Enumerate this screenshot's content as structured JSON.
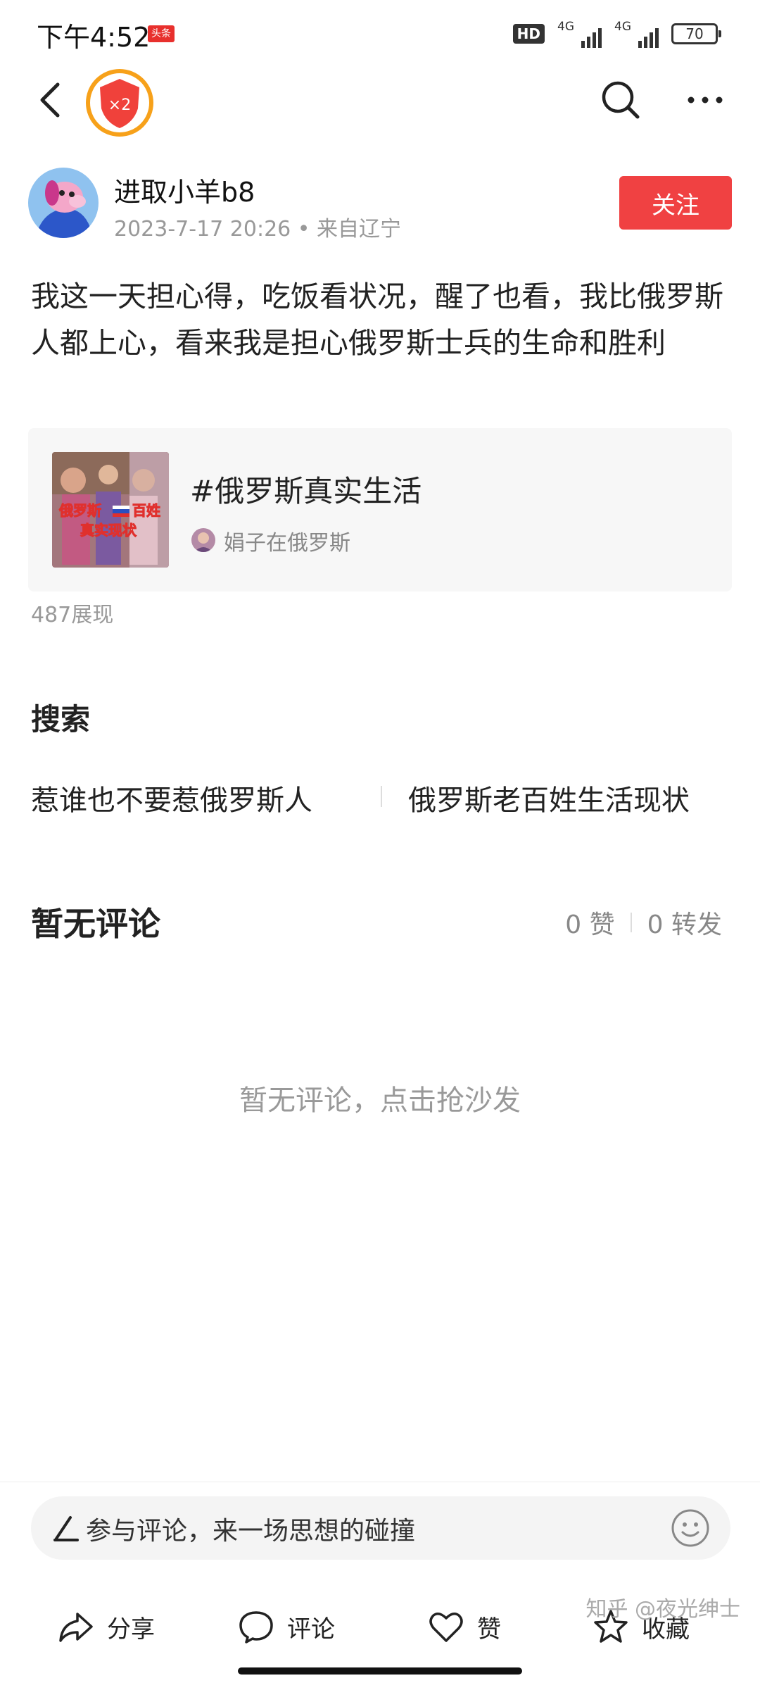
{
  "status_bar": {
    "time": "下午4:52",
    "app_badge": "头条",
    "hd_label": "HD",
    "net1": "4G",
    "net2": "4G",
    "battery": "70"
  },
  "nav": {
    "reward_label": "×2"
  },
  "author": {
    "name": "进取小羊b8",
    "meta": "2023-7-17 20:26 • 来自辽宁",
    "follow_label": "关注"
  },
  "post": {
    "text": "我这一天担心得，吃饭看状况，醒了也看，我比俄罗斯人都上心，看来我是担心俄罗斯士兵的生命和胜利",
    "views": "487展现"
  },
  "topic": {
    "title": "#俄罗斯真实生活",
    "thumb_caption_1": "俄罗斯",
    "thumb_caption_2": "百姓",
    "thumb_caption_3": "真实现状",
    "source": "娟子在俄罗斯"
  },
  "search": {
    "title": "搜索",
    "keywords": [
      "惹谁也不要惹俄罗斯人",
      "俄罗斯老百姓生活现状"
    ]
  },
  "comments": {
    "title": "暂无评论",
    "likes": "0 赞",
    "reposts": "0 转发",
    "empty_text": "暂无评论，点击抢沙发"
  },
  "bottom": {
    "input_placeholder": "参与评论，来一场思想的碰撞",
    "share_label": "分享",
    "comment_label": "评论",
    "like_label": "赞",
    "favorite_label": "收藏"
  },
  "watermark": "知乎 @夜光绅士"
}
